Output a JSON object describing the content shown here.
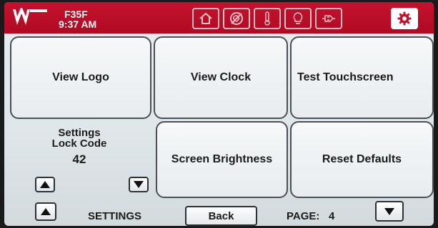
{
  "header": {
    "unit_name": "F35F",
    "time": "9:37 AM",
    "icons": [
      "home-icon",
      "fan-off-icon",
      "thermometer-icon",
      "light-bulb-icon",
      "plug-icon",
      "gear-icon"
    ],
    "active_icon": "gear-icon",
    "colors": {
      "bar": "#c4122e",
      "icon": "#f3c1c8",
      "active_icon": "#c4122e"
    }
  },
  "tiles": {
    "view_logo": "View Logo",
    "view_clock": "View Clock",
    "test_touchscreen": "Test Touchscreen",
    "screen_brightness": "Screen Brightness",
    "reset_defaults": "Reset Defaults"
  },
  "lock_code": {
    "label": "Settings Lock Code",
    "value": "42"
  },
  "footer": {
    "section": "SETTINGS",
    "back": "Back",
    "page_label": "PAGE:",
    "page_number": "4"
  }
}
